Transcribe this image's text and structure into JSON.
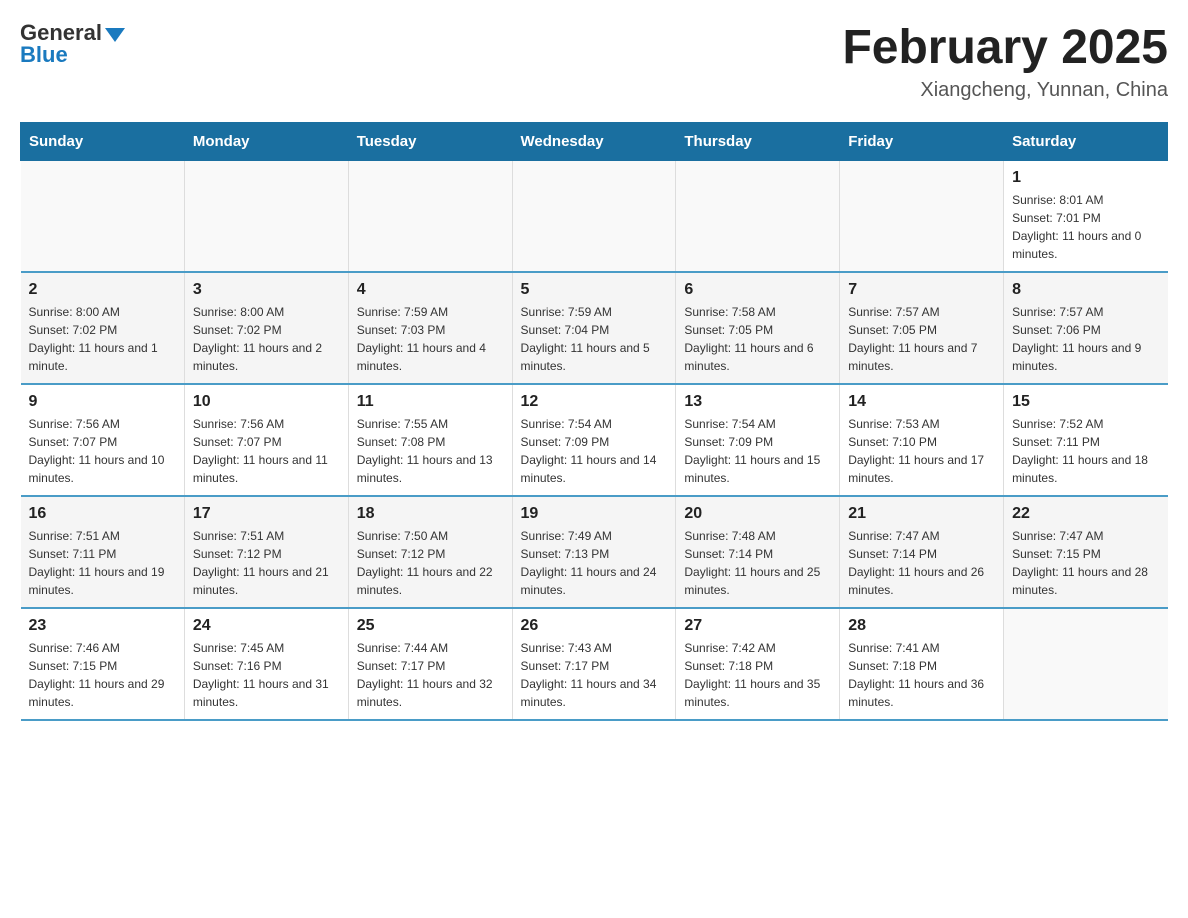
{
  "header": {
    "logo_general": "General",
    "logo_blue": "Blue",
    "month_title": "February 2025",
    "location": "Xiangcheng, Yunnan, China"
  },
  "weekdays": [
    "Sunday",
    "Monday",
    "Tuesday",
    "Wednesday",
    "Thursday",
    "Friday",
    "Saturday"
  ],
  "weeks": [
    [
      {
        "day": "",
        "sunrise": "",
        "sunset": "",
        "daylight": ""
      },
      {
        "day": "",
        "sunrise": "",
        "sunset": "",
        "daylight": ""
      },
      {
        "day": "",
        "sunrise": "",
        "sunset": "",
        "daylight": ""
      },
      {
        "day": "",
        "sunrise": "",
        "sunset": "",
        "daylight": ""
      },
      {
        "day": "",
        "sunrise": "",
        "sunset": "",
        "daylight": ""
      },
      {
        "day": "",
        "sunrise": "",
        "sunset": "",
        "daylight": ""
      },
      {
        "day": "1",
        "sunrise": "Sunrise: 8:01 AM",
        "sunset": "Sunset: 7:01 PM",
        "daylight": "Daylight: 11 hours and 0 minutes."
      }
    ],
    [
      {
        "day": "2",
        "sunrise": "Sunrise: 8:00 AM",
        "sunset": "Sunset: 7:02 PM",
        "daylight": "Daylight: 11 hours and 1 minute."
      },
      {
        "day": "3",
        "sunrise": "Sunrise: 8:00 AM",
        "sunset": "Sunset: 7:02 PM",
        "daylight": "Daylight: 11 hours and 2 minutes."
      },
      {
        "day": "4",
        "sunrise": "Sunrise: 7:59 AM",
        "sunset": "Sunset: 7:03 PM",
        "daylight": "Daylight: 11 hours and 4 minutes."
      },
      {
        "day": "5",
        "sunrise": "Sunrise: 7:59 AM",
        "sunset": "Sunset: 7:04 PM",
        "daylight": "Daylight: 11 hours and 5 minutes."
      },
      {
        "day": "6",
        "sunrise": "Sunrise: 7:58 AM",
        "sunset": "Sunset: 7:05 PM",
        "daylight": "Daylight: 11 hours and 6 minutes."
      },
      {
        "day": "7",
        "sunrise": "Sunrise: 7:57 AM",
        "sunset": "Sunset: 7:05 PM",
        "daylight": "Daylight: 11 hours and 7 minutes."
      },
      {
        "day": "8",
        "sunrise": "Sunrise: 7:57 AM",
        "sunset": "Sunset: 7:06 PM",
        "daylight": "Daylight: 11 hours and 9 minutes."
      }
    ],
    [
      {
        "day": "9",
        "sunrise": "Sunrise: 7:56 AM",
        "sunset": "Sunset: 7:07 PM",
        "daylight": "Daylight: 11 hours and 10 minutes."
      },
      {
        "day": "10",
        "sunrise": "Sunrise: 7:56 AM",
        "sunset": "Sunset: 7:07 PM",
        "daylight": "Daylight: 11 hours and 11 minutes."
      },
      {
        "day": "11",
        "sunrise": "Sunrise: 7:55 AM",
        "sunset": "Sunset: 7:08 PM",
        "daylight": "Daylight: 11 hours and 13 minutes."
      },
      {
        "day": "12",
        "sunrise": "Sunrise: 7:54 AM",
        "sunset": "Sunset: 7:09 PM",
        "daylight": "Daylight: 11 hours and 14 minutes."
      },
      {
        "day": "13",
        "sunrise": "Sunrise: 7:54 AM",
        "sunset": "Sunset: 7:09 PM",
        "daylight": "Daylight: 11 hours and 15 minutes."
      },
      {
        "day": "14",
        "sunrise": "Sunrise: 7:53 AM",
        "sunset": "Sunset: 7:10 PM",
        "daylight": "Daylight: 11 hours and 17 minutes."
      },
      {
        "day": "15",
        "sunrise": "Sunrise: 7:52 AM",
        "sunset": "Sunset: 7:11 PM",
        "daylight": "Daylight: 11 hours and 18 minutes."
      }
    ],
    [
      {
        "day": "16",
        "sunrise": "Sunrise: 7:51 AM",
        "sunset": "Sunset: 7:11 PM",
        "daylight": "Daylight: 11 hours and 19 minutes."
      },
      {
        "day": "17",
        "sunrise": "Sunrise: 7:51 AM",
        "sunset": "Sunset: 7:12 PM",
        "daylight": "Daylight: 11 hours and 21 minutes."
      },
      {
        "day": "18",
        "sunrise": "Sunrise: 7:50 AM",
        "sunset": "Sunset: 7:12 PM",
        "daylight": "Daylight: 11 hours and 22 minutes."
      },
      {
        "day": "19",
        "sunrise": "Sunrise: 7:49 AM",
        "sunset": "Sunset: 7:13 PM",
        "daylight": "Daylight: 11 hours and 24 minutes."
      },
      {
        "day": "20",
        "sunrise": "Sunrise: 7:48 AM",
        "sunset": "Sunset: 7:14 PM",
        "daylight": "Daylight: 11 hours and 25 minutes."
      },
      {
        "day": "21",
        "sunrise": "Sunrise: 7:47 AM",
        "sunset": "Sunset: 7:14 PM",
        "daylight": "Daylight: 11 hours and 26 minutes."
      },
      {
        "day": "22",
        "sunrise": "Sunrise: 7:47 AM",
        "sunset": "Sunset: 7:15 PM",
        "daylight": "Daylight: 11 hours and 28 minutes."
      }
    ],
    [
      {
        "day": "23",
        "sunrise": "Sunrise: 7:46 AM",
        "sunset": "Sunset: 7:15 PM",
        "daylight": "Daylight: 11 hours and 29 minutes."
      },
      {
        "day": "24",
        "sunrise": "Sunrise: 7:45 AM",
        "sunset": "Sunset: 7:16 PM",
        "daylight": "Daylight: 11 hours and 31 minutes."
      },
      {
        "day": "25",
        "sunrise": "Sunrise: 7:44 AM",
        "sunset": "Sunset: 7:17 PM",
        "daylight": "Daylight: 11 hours and 32 minutes."
      },
      {
        "day": "26",
        "sunrise": "Sunrise: 7:43 AM",
        "sunset": "Sunset: 7:17 PM",
        "daylight": "Daylight: 11 hours and 34 minutes."
      },
      {
        "day": "27",
        "sunrise": "Sunrise: 7:42 AM",
        "sunset": "Sunset: 7:18 PM",
        "daylight": "Daylight: 11 hours and 35 minutes."
      },
      {
        "day": "28",
        "sunrise": "Sunrise: 7:41 AM",
        "sunset": "Sunset: 7:18 PM",
        "daylight": "Daylight: 11 hours and 36 minutes."
      },
      {
        "day": "",
        "sunrise": "",
        "sunset": "",
        "daylight": ""
      }
    ]
  ]
}
